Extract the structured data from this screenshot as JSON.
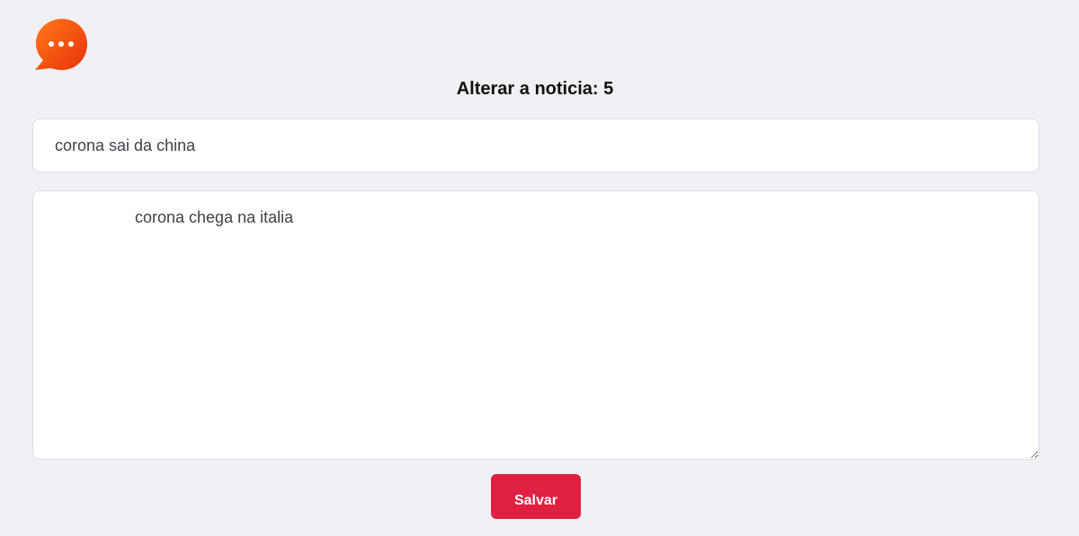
{
  "page": {
    "title": "Alterar a noticia: 5"
  },
  "form": {
    "title_value": "corona sai da china",
    "body_value": "corona chega na italia",
    "save_label": "Salvar"
  },
  "icons": {
    "logo": "chat-bubble-icon"
  },
  "colors": {
    "background": "#f0f0f5",
    "accent": "#e02041",
    "logo_orange": "#f25c05"
  }
}
